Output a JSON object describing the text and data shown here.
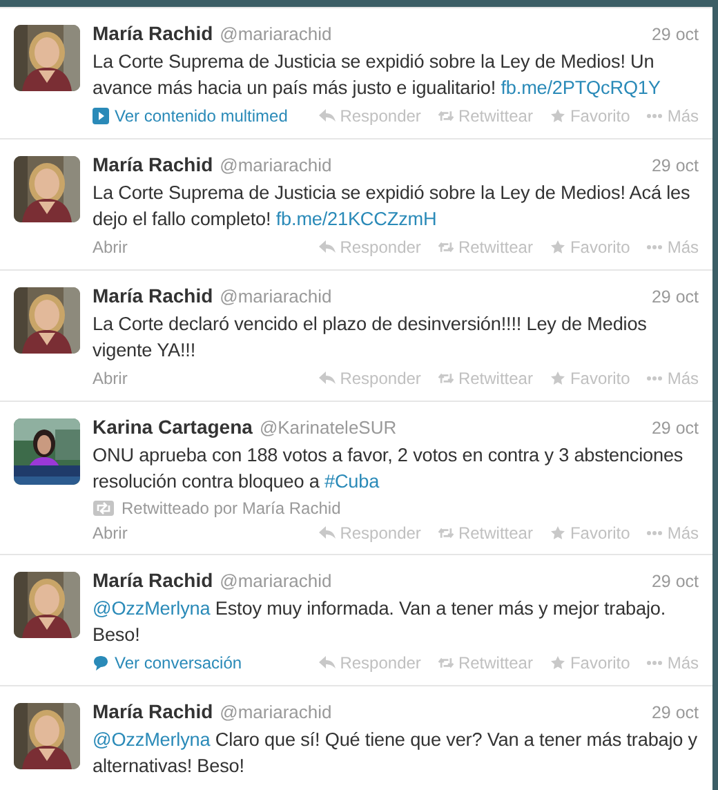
{
  "tweets": [
    {
      "name": "María Rachid",
      "handle": "@mariarachid",
      "time": "29 oct",
      "text": [
        {
          "kind": "plain",
          "text": "La Corte Suprema de Justicia se expidió sobre la Ley de Medios! Un avance más hacia un país más justo e igualitario! "
        },
        {
          "kind": "link",
          "text": "fb.me/2PTQcRQ1Y"
        }
      ],
      "footer": {
        "kind": "media",
        "label": "Ver contenido multimed"
      },
      "actions": [
        "Responder",
        "Retwittear",
        "Favorito",
        "Más"
      ]
    },
    {
      "name": "María Rachid",
      "handle": "@mariarachid",
      "time": "29 oct",
      "text": [
        {
          "kind": "plain",
          "text": "La Corte Suprema de Justicia se expidió sobre la Ley de Medios! Acá les dejo el fallo completo! "
        },
        {
          "kind": "link",
          "text": "fb.me/21KCCZzmH"
        }
      ],
      "footer": {
        "kind": "open",
        "label": "Abrir"
      },
      "actions": [
        "Responder",
        "Retwittear",
        "Favorito",
        "Más"
      ]
    },
    {
      "name": "María Rachid",
      "handle": "@mariarachid",
      "time": "29 oct",
      "text": [
        {
          "kind": "plain",
          "text": "La Corte declaró vencido el plazo de desinversión!!!! Ley de Medios vigente YA!!!"
        }
      ],
      "footer": {
        "kind": "open",
        "label": "Abrir"
      },
      "actions": [
        "Responder",
        "Retwittear",
        "Favorito",
        "Más"
      ]
    },
    {
      "name": "Karina Cartagena",
      "handle": "@KarinateleSUR",
      "time": "29 oct",
      "text": [
        {
          "kind": "plain",
          "text": "ONU aprueba con 188 votos a favor, 2 votos en contra y 3 abstenciones resolución contra bloqueo a "
        },
        {
          "kind": "link",
          "text": "#Cuba"
        }
      ],
      "retweeted_by": "Retwitteado por María Rachid",
      "footer": {
        "kind": "open",
        "label": "Abrir"
      },
      "actions": [
        "Responder",
        "Retwittear",
        "Favorito",
        "Más"
      ]
    },
    {
      "name": "María Rachid",
      "handle": "@mariarachid",
      "time": "29 oct",
      "text": [
        {
          "kind": "link",
          "text": "@OzzMerlyna"
        },
        {
          "kind": "plain",
          "text": " Estoy muy informada. Van a tener más y mejor trabajo. Beso!"
        }
      ],
      "footer": {
        "kind": "conversation",
        "label": "Ver conversación"
      },
      "actions": [
        "Responder",
        "Retwittear",
        "Favorito",
        "Más"
      ]
    },
    {
      "name": "María Rachid",
      "handle": "@mariarachid",
      "time": "29 oct",
      "text": [
        {
          "kind": "link",
          "text": "@OzzMerlyna"
        },
        {
          "kind": "plain",
          "text": " Claro que sí! Qué tiene que ver? Van a tener más trabajo y alternativas! Beso!"
        }
      ]
    }
  ]
}
